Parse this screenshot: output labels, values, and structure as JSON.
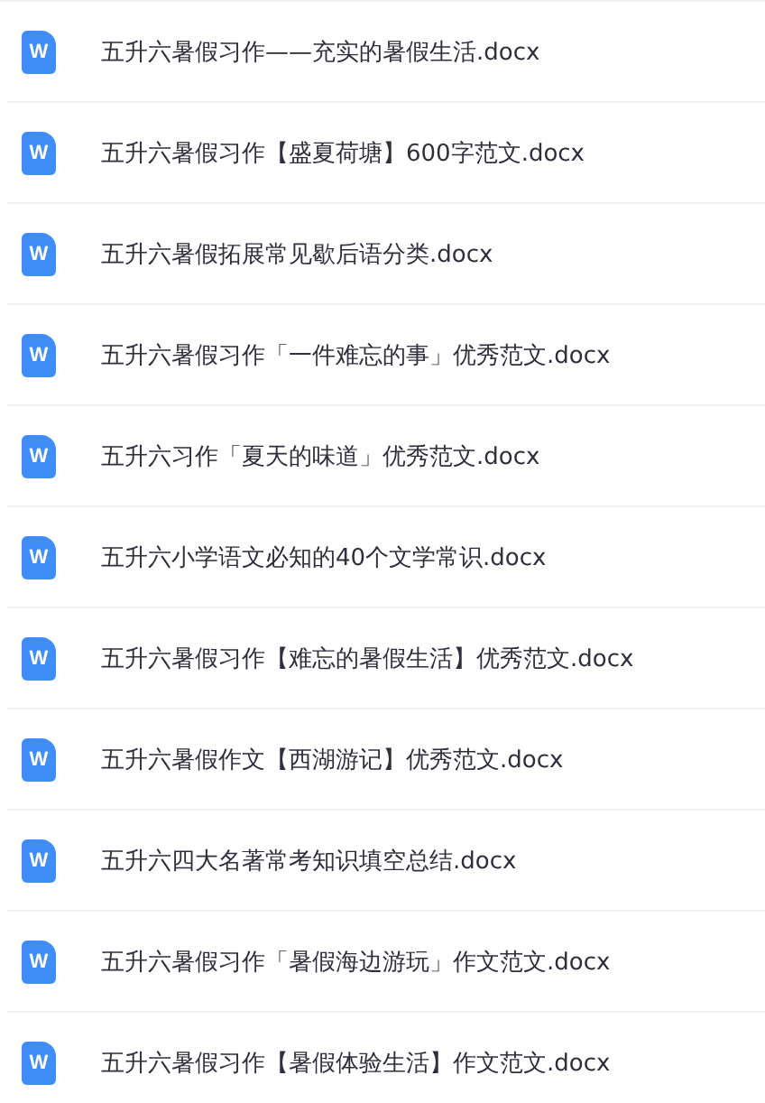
{
  "files": [
    {
      "icon_label": "W",
      "name": "五升六暑假习作——充实的暑假生活.docx"
    },
    {
      "icon_label": "W",
      "name": "五升六暑假习作【盛夏荷塘】600字范文.docx"
    },
    {
      "icon_label": "W",
      "name": "五升六暑假拓展常见歇后语分类.docx"
    },
    {
      "icon_label": "W",
      "name": "五升六暑假习作「一件难忘的事」优秀范文.docx"
    },
    {
      "icon_label": "W",
      "name": "五升六习作「夏天的味道」优秀范文.docx"
    },
    {
      "icon_label": "W",
      "name": "五升六小学语文必知的40个文学常识.docx"
    },
    {
      "icon_label": "W",
      "name": "五升六暑假习作【难忘的暑假生活】优秀范文.docx"
    },
    {
      "icon_label": "W",
      "name": "五升六暑假作文【西湖游记】优秀范文.docx"
    },
    {
      "icon_label": "W",
      "name": "五升六四大名著常考知识填空总结.docx"
    },
    {
      "icon_label": "W",
      "name": "五升六暑假习作「暑假海边游玩」作文范文.docx"
    },
    {
      "icon_label": "W",
      "name": "五升六暑假习作【暑假体验生活】作文范文.docx"
    }
  ]
}
